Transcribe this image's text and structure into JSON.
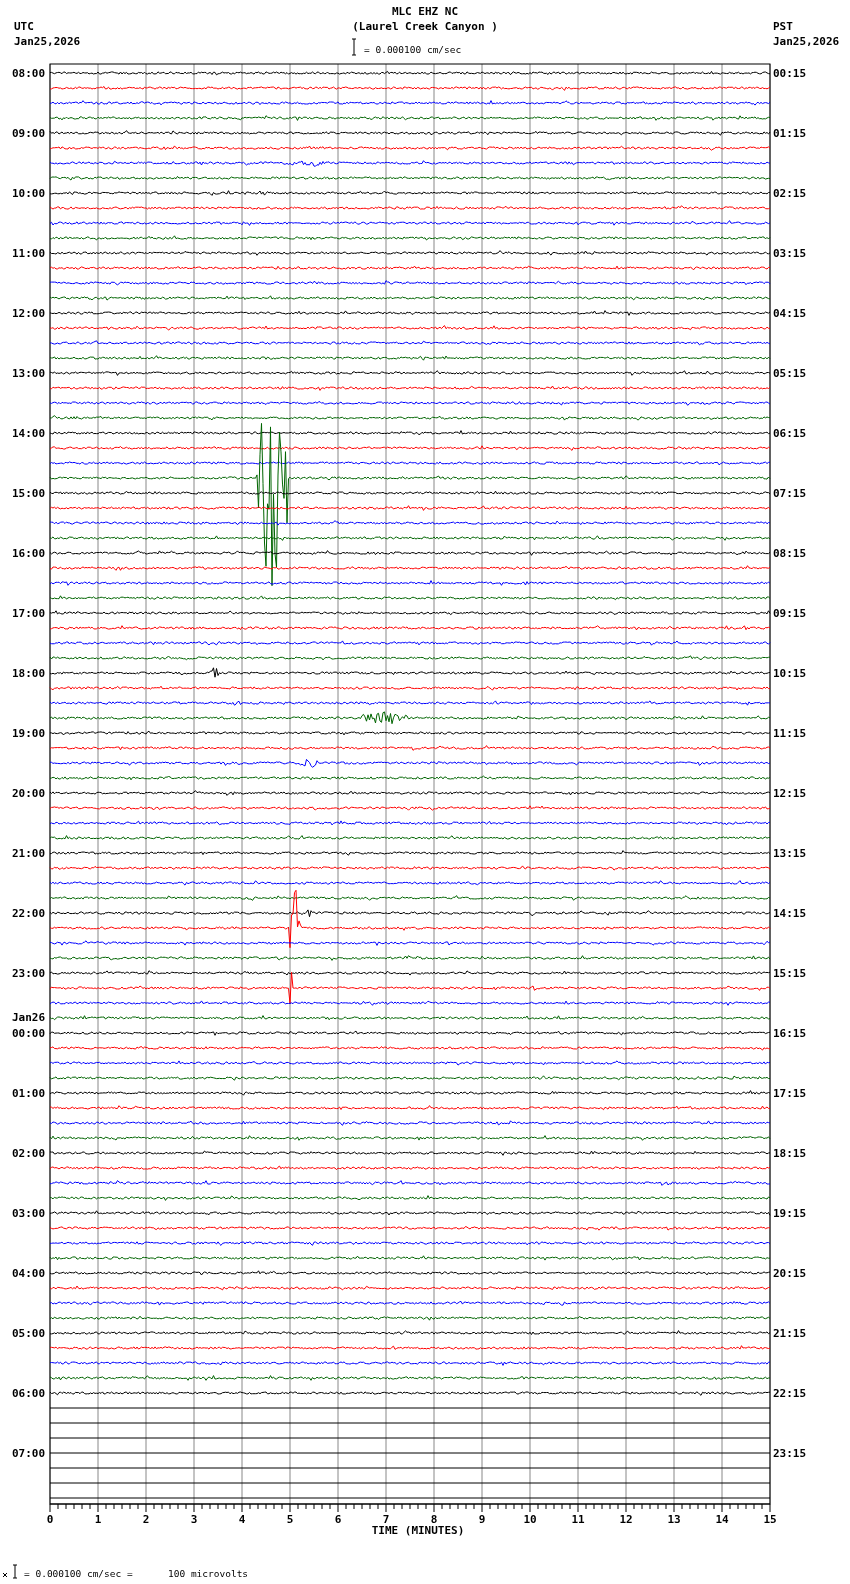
{
  "title": "MLC EHZ NC",
  "station": "(Laurel Creek Canyon )",
  "left": {
    "zone": "UTC",
    "date": "Jan25,2026"
  },
  "right": {
    "zone": "PST",
    "date": "Jan25,2026"
  },
  "scale": "= 0.000100 cm/sec",
  "hours": [
    {
      "utc": "08:00",
      "pst": "00:15",
      "traces": [
        {
          "color": "#000000",
          "kind": "signal"
        },
        {
          "color": "#ff0000",
          "kind": "signal"
        },
        {
          "color": "#0000ff",
          "kind": "signal"
        },
        {
          "color": "#006400",
          "kind": "signal"
        }
      ]
    },
    {
      "utc": "09:00",
      "pst": "01:15",
      "traces": [
        {
          "color": "#000000",
          "kind": "signal"
        },
        {
          "color": "#ff0000",
          "kind": "signal"
        },
        {
          "color": "#0000ff",
          "kind": "signal"
        },
        {
          "color": "#006400",
          "kind": "signal"
        }
      ]
    },
    {
      "utc": "10:00",
      "pst": "02:15",
      "traces": [
        {
          "color": "#000000",
          "kind": "signal"
        },
        {
          "color": "#ff0000",
          "kind": "signal"
        },
        {
          "color": "#0000ff",
          "kind": "signal"
        },
        {
          "color": "#006400",
          "kind": "signal"
        }
      ]
    },
    {
      "utc": "11:00",
      "pst": "03:15",
      "traces": [
        {
          "color": "#000000",
          "kind": "signal"
        },
        {
          "color": "#ff0000",
          "kind": "signal"
        },
        {
          "color": "#0000ff",
          "kind": "signal"
        },
        {
          "color": "#006400",
          "kind": "signal"
        }
      ]
    },
    {
      "utc": "12:00",
      "pst": "04:15",
      "traces": [
        {
          "color": "#000000",
          "kind": "signal"
        },
        {
          "color": "#ff0000",
          "kind": "signal"
        },
        {
          "color": "#0000ff",
          "kind": "signal"
        },
        {
          "color": "#006400",
          "kind": "signal"
        }
      ]
    },
    {
      "utc": "13:00",
      "pst": "05:15",
      "traces": [
        {
          "color": "#000000",
          "kind": "signal"
        },
        {
          "color": "#ff0000",
          "kind": "signal"
        },
        {
          "color": "#0000ff",
          "kind": "signal"
        },
        {
          "color": "#006400",
          "kind": "signal"
        }
      ]
    },
    {
      "utc": "14:00",
      "pst": "06:15",
      "traces": [
        {
          "color": "#000000",
          "kind": "signal"
        },
        {
          "color": "#ff0000",
          "kind": "signal"
        },
        {
          "color": "#0000ff",
          "kind": "signal"
        },
        {
          "color": "#006400",
          "kind": "signal"
        }
      ]
    },
    {
      "utc": "15:00",
      "pst": "07:15",
      "traces": [
        {
          "color": "#000000",
          "kind": "signal"
        },
        {
          "color": "#ff0000",
          "kind": "signal"
        },
        {
          "color": "#0000ff",
          "kind": "signal"
        },
        {
          "color": "#006400",
          "kind": "signal"
        }
      ]
    },
    {
      "utc": "16:00",
      "pst": "08:15",
      "traces": [
        {
          "color": "#000000",
          "kind": "signal"
        },
        {
          "color": "#ff0000",
          "kind": "signal"
        },
        {
          "color": "#0000ff",
          "kind": "signal"
        },
        {
          "color": "#006400",
          "kind": "signal"
        }
      ]
    },
    {
      "utc": "17:00",
      "pst": "09:15",
      "traces": [
        {
          "color": "#000000",
          "kind": "signal"
        },
        {
          "color": "#ff0000",
          "kind": "signal"
        },
        {
          "color": "#0000ff",
          "kind": "signal"
        },
        {
          "color": "#006400",
          "kind": "signal"
        }
      ]
    },
    {
      "utc": "18:00",
      "pst": "10:15",
      "traces": [
        {
          "color": "#000000",
          "kind": "signal"
        },
        {
          "color": "#ff0000",
          "kind": "signal"
        },
        {
          "color": "#0000ff",
          "kind": "signal"
        },
        {
          "color": "#006400",
          "kind": "signal"
        }
      ]
    },
    {
      "utc": "19:00",
      "pst": "11:15",
      "traces": [
        {
          "color": "#000000",
          "kind": "signal"
        },
        {
          "color": "#ff0000",
          "kind": "signal"
        },
        {
          "color": "#0000ff",
          "kind": "signal"
        },
        {
          "color": "#006400",
          "kind": "signal"
        }
      ]
    },
    {
      "utc": "20:00",
      "pst": "12:15",
      "traces": [
        {
          "color": "#000000",
          "kind": "signal"
        },
        {
          "color": "#ff0000",
          "kind": "signal"
        },
        {
          "color": "#0000ff",
          "kind": "signal"
        },
        {
          "color": "#006400",
          "kind": "signal"
        }
      ]
    },
    {
      "utc": "21:00",
      "pst": "13:15",
      "traces": [
        {
          "color": "#000000",
          "kind": "signal"
        },
        {
          "color": "#ff0000",
          "kind": "signal"
        },
        {
          "color": "#0000ff",
          "kind": "signal"
        },
        {
          "color": "#006400",
          "kind": "signal"
        }
      ]
    },
    {
      "utc": "22:00",
      "pst": "14:15",
      "traces": [
        {
          "color": "#000000",
          "kind": "signal"
        },
        {
          "color": "#ff0000",
          "kind": "signal"
        },
        {
          "color": "#0000ff",
          "kind": "signal"
        },
        {
          "color": "#006400",
          "kind": "signal"
        }
      ]
    },
    {
      "utc": "23:00",
      "pst": "15:15",
      "traces": [
        {
          "color": "#000000",
          "kind": "signal"
        },
        {
          "color": "#ff0000",
          "kind": "signal"
        },
        {
          "color": "#0000ff",
          "kind": "signal"
        },
        {
          "color": "#006400",
          "kind": "signal"
        }
      ]
    },
    {
      "date": "Jan26",
      "utc": "00:00",
      "pst": "16:15",
      "traces": [
        {
          "color": "#000000",
          "kind": "signal"
        },
        {
          "color": "#ff0000",
          "kind": "signal"
        },
        {
          "color": "#0000ff",
          "kind": "signal"
        },
        {
          "color": "#006400",
          "kind": "signal"
        }
      ]
    },
    {
      "utc": "01:00",
      "pst": "17:15",
      "traces": [
        {
          "color": "#000000",
          "kind": "signal"
        },
        {
          "color": "#ff0000",
          "kind": "signal"
        },
        {
          "color": "#0000ff",
          "kind": "signal"
        },
        {
          "color": "#006400",
          "kind": "signal"
        }
      ]
    },
    {
      "utc": "02:00",
      "pst": "18:15",
      "traces": [
        {
          "color": "#000000",
          "kind": "signal"
        },
        {
          "color": "#ff0000",
          "kind": "signal"
        },
        {
          "color": "#0000ff",
          "kind": "signal"
        },
        {
          "color": "#006400",
          "kind": "signal"
        }
      ]
    },
    {
      "utc": "03:00",
      "pst": "19:15",
      "traces": [
        {
          "color": "#000000",
          "kind": "signal"
        },
        {
          "color": "#ff0000",
          "kind": "signal"
        },
        {
          "color": "#0000ff",
          "kind": "signal"
        },
        {
          "color": "#006400",
          "kind": "signal"
        }
      ]
    },
    {
      "utc": "04:00",
      "pst": "20:15",
      "traces": [
        {
          "color": "#000000",
          "kind": "signal"
        },
        {
          "color": "#ff0000",
          "kind": "signal"
        },
        {
          "color": "#0000ff",
          "kind": "signal"
        },
        {
          "color": "#006400",
          "kind": "signal"
        }
      ]
    },
    {
      "utc": "05:00",
      "pst": "21:15",
      "traces": [
        {
          "color": "#000000",
          "kind": "signal"
        },
        {
          "color": "#ff0000",
          "kind": "signal"
        },
        {
          "color": "#0000ff",
          "kind": "signal"
        },
        {
          "color": "#006400",
          "kind": "signal"
        }
      ]
    },
    {
      "utc": "06:00",
      "pst": "22:15",
      "traces": [
        {
          "color": "#000000",
          "kind": "signal"
        },
        {
          "kind": "flat"
        },
        {
          "kind": "flat"
        },
        {
          "kind": "flat"
        }
      ]
    },
    {
      "utc": "07:00",
      "pst": "23:15",
      "traces": [
        {
          "kind": "flat"
        },
        {
          "kind": "flat"
        },
        {
          "kind": "flat"
        },
        {
          "kind": "flat"
        }
      ]
    }
  ],
  "xticks": [
    "0",
    "1",
    "2",
    "3",
    "4",
    "5",
    "6",
    "7",
    "8",
    "9",
    "10",
    "11",
    "12",
    "13",
    "14",
    "15"
  ],
  "xlabel": "TIME (MINUTES)",
  "footer": {
    "scale": "= 0.000100 cm/sec =",
    "value": "100 microvolts"
  }
}
